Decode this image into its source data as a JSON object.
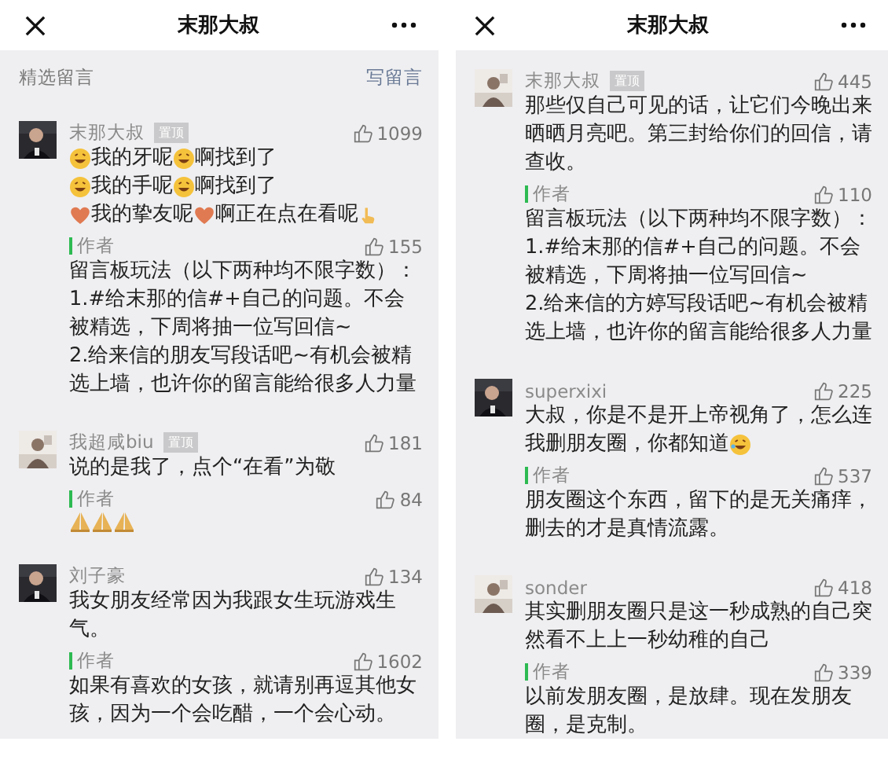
{
  "panels": [
    {
      "title": "末那大叔",
      "section": {
        "label": "精选留言",
        "action": "写留言"
      },
      "comments": [
        {
          "name": "末那大叔",
          "pinned": true,
          "badge": "置顶",
          "likes": "1099",
          "lines": [
            [
              {
                "kind": "grin"
              },
              {
                "kind": "text",
                "text": "我的牙呢 "
              },
              {
                "kind": "grin"
              },
              {
                "kind": "text",
                "text": "啊找到了"
              }
            ],
            [
              {
                "kind": "grin"
              },
              {
                "kind": "text",
                "text": "我的手呢 "
              },
              {
                "kind": "grin"
              },
              {
                "kind": "text",
                "text": "啊找到了"
              }
            ],
            [
              {
                "kind": "heart"
              },
              {
                "kind": "text",
                "text": "我的挚友呢 "
              },
              {
                "kind": "heart"
              },
              {
                "kind": "text",
                "text": "啊正在点在看呢"
              },
              {
                "kind": "hand"
              }
            ]
          ],
          "reply": {
            "label": "作者",
            "likes": "155",
            "text": "留言板玩法（以下两种均不限字数）：\n1.#给末那的信#+自己的问题。不会被精选，下周将抽一位写回信~\n2.给来信的朋友写段话吧~有机会被精选上墙，也许你的留言能给很多人力量"
          }
        },
        {
          "name": "我超咸biu",
          "pinned": true,
          "badge": "置顶",
          "likes": "181",
          "text": "说的是我了，点个“在看”为敬",
          "reply": {
            "label": "作者",
            "likes": "84",
            "lines": [
              [
                {
                  "kind": "palms"
                },
                {
                  "kind": "palms"
                },
                {
                  "kind": "palms"
                }
              ]
            ]
          }
        },
        {
          "name": "刘子豪",
          "pinned": false,
          "likes": "134",
          "text": "我女朋友经常因为我跟女生玩游戏生气。",
          "reply": {
            "label": "作者",
            "likes": "1602",
            "text": "如果有喜欢的女孩，就请别再逗其他女孩，因为一个会吃醋，一个会心动。"
          }
        }
      ]
    },
    {
      "title": "末那大叔",
      "comments": [
        {
          "name": "末那大叔",
          "pinned": true,
          "badge": "置顶",
          "likes": "445",
          "text": "那些仅自己可见的话，让它们今晚出来晒晒月亮吧。第三封给你们的回信，请查收。",
          "reply": {
            "label": "作者",
            "likes": "110",
            "text": "留言板玩法（以下两种均不限字数）：\n1.#给末那的信#+自己的问题。不会被精选，下周将抽一位写回信~\n2.给来信的方婷写段话吧~有机会被精选上墙，也许你的留言能给很多人力量"
          }
        },
        {
          "name": "superxixi",
          "pinned": false,
          "likes": "225",
          "lines": [
            [
              {
                "kind": "text",
                "text": "大叔，你是不是开上帝视角了，怎么连"
              }
            ],
            [
              {
                "kind": "text",
                "text": "我删朋友圈，你都知道"
              },
              {
                "kind": "laugh"
              }
            ]
          ],
          "reply": {
            "label": "作者",
            "likes": "537",
            "text": "朋友圈这个东西，留下的是无关痛痒，删去的才是真情流露。"
          }
        },
        {
          "name": "sonder",
          "pinned": false,
          "likes": "418",
          "text": "其实删朋友圈只是这一秒成熟的自己突然看不上上一秒幼稚的自己",
          "reply": {
            "label": "作者",
            "likes": "339",
            "text": "以前发朋友圈，是放肆。现在发朋友圈，是克制。"
          }
        }
      ]
    }
  ]
}
